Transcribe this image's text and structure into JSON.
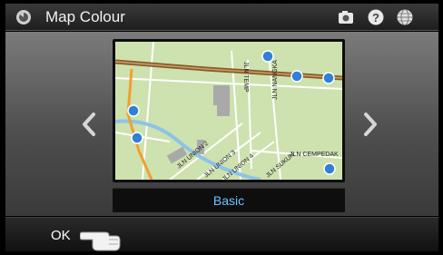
{
  "header": {
    "title": "Map Colour"
  },
  "icons": {
    "back": "back-icon",
    "camera": "camera-icon",
    "help": "help-icon",
    "globe": "globe-icon",
    "prev": "chevron-left-icon",
    "next": "chevron-right-icon",
    "pointer": "hand-pointer-icon"
  },
  "map": {
    "streets": [
      "JLN TEMP",
      "JLN NANGKA",
      "JLN CEMPEDAK",
      "JLN UNION 2",
      "JLN UNION 3",
      "JLN UNION 4",
      "JLN SUKUN"
    ]
  },
  "caption": "Basic",
  "footer": {
    "ok_label": "OK"
  },
  "colors": {
    "caption_text": "#6fc3ff",
    "map_land": "#cde2ae",
    "road_major": "#8a5a2a"
  }
}
